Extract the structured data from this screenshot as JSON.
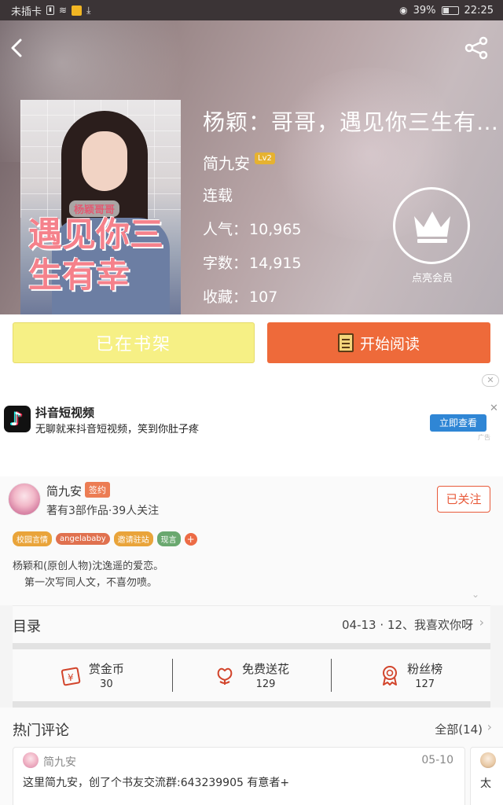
{
  "status_bar": {
    "carrier": "未插卡",
    "battery": "39%",
    "time": "22:25"
  },
  "book": {
    "title": "杨颖：哥哥，遇见你三生有…",
    "author": "简九安",
    "author_level": "Lv2",
    "status": "连载",
    "popularity_label": "人气：",
    "popularity": "10,965",
    "wordcount_label": "字数：",
    "wordcount": "14,915",
    "favorites_label": "收藏：",
    "favorites": "107",
    "cover_subtitle": "杨颖哥哥",
    "cover_title": "遇见你三生有幸",
    "vip_label": "点亮会员"
  },
  "actions": {
    "shelf_label": "已在书架",
    "read_label": "开始阅读"
  },
  "ad": {
    "close_label": "✕",
    "title": "抖音短视频",
    "description": "无聊就来抖音短视频，笑到你肚子疼",
    "button": "立即查看",
    "tag": "广告"
  },
  "author_section": {
    "name": "简九安",
    "badge": "签约",
    "stats": "著有3部作品·39人关注",
    "follow_label": "已关注",
    "tags": [
      {
        "label": "校园言情",
        "color": "#e9a43a"
      },
      {
        "label": "angelababy",
        "color": "#e0714f"
      },
      {
        "label": "邀请驻站",
        "color": "#e9a43a"
      },
      {
        "label": "现言",
        "color": "#6aa86f"
      }
    ],
    "tag_more": "+",
    "intro_line1": "杨颖和(原创人物)沈逸遥的爱恋。",
    "intro_line2": "第一次写同人文，不喜勿喷。"
  },
  "toc": {
    "label": "目录",
    "latest": "04-13 · 12、我喜欢你呀"
  },
  "stats": [
    {
      "label": "赏金币",
      "value": "30",
      "icon": "gold-coin-icon"
    },
    {
      "label": "免费送花",
      "value": "129",
      "icon": "flower-icon"
    },
    {
      "label": "粉丝榜",
      "value": "127",
      "icon": "medal-icon"
    }
  ],
  "comments": {
    "title": "热门评论",
    "all_label": "全部(14)",
    "items": [
      {
        "user": "简九安",
        "date": "05-10",
        "text": "这里简九安，创了个书友交流群:643239905 有意者+"
      },
      {
        "text": "太"
      }
    ]
  },
  "colors": {
    "accent_orange": "#ee6a3a",
    "shelf_yellow": "#f6f085",
    "ad_blue": "#2f86d5"
  }
}
